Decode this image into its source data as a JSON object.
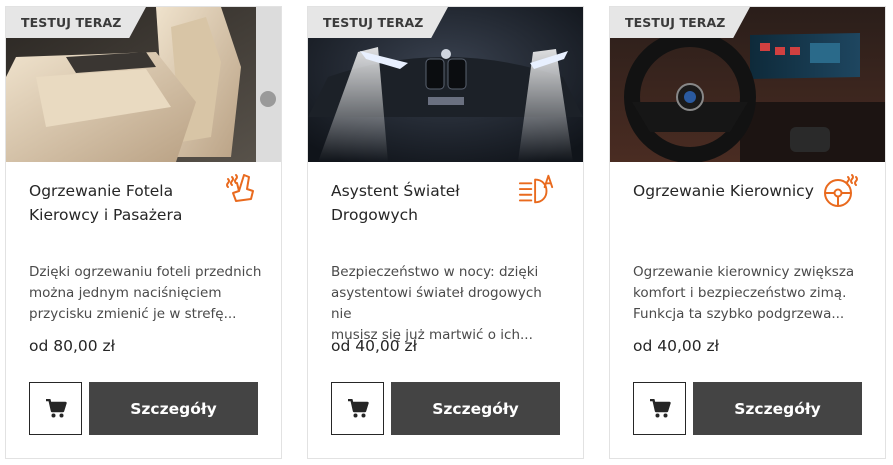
{
  "colors": {
    "accent": "#e96a1e",
    "button_bg": "#444444",
    "badge_bg": "#e6e6e6",
    "border": "#e2e2e2"
  },
  "cards": [
    {
      "badge": "TESTUJ TERAZ",
      "title_line1": "Ogrzewanie Fotela",
      "title_line2": "Kierowcy i Pasażera",
      "icon": "heated-seat-icon",
      "desc_line1": "Dzięki ogrzewaniu foteli przednich",
      "desc_line2": "można jednym naciśnięciem",
      "desc_line3": "przycisku zmienić je w strefę...",
      "price": "od 80,00 zł",
      "cart_icon": "cart-icon",
      "details_label": "Szczegóły"
    },
    {
      "badge": "TESTUJ TERAZ",
      "title_line1": "Asystent Świateł",
      "title_line2": "Drogowych",
      "icon": "high-beam-assistant-icon",
      "desc_line1": "Bezpieczeństwo w nocy: dzięki",
      "desc_line2": "asystentowi świateł drogowych nie",
      "desc_line3": "musisz się już martwić o ich...",
      "price": "od 40,00 zł",
      "cart_icon": "cart-icon",
      "details_label": "Szczegóły"
    },
    {
      "badge": "TESTUJ TERAZ",
      "title_line1": "Ogrzewanie Kierownicy",
      "title_line2": "",
      "icon": "heated-steering-wheel-icon",
      "desc_line1": "Ogrzewanie kierownicy zwiększa",
      "desc_line2": "komfort i bezpieczeństwo zimą.",
      "desc_line3": "Funkcja ta szybko podgrzewa...",
      "price": "od 40,00 zł",
      "cart_icon": "cart-icon",
      "details_label": "Szczegóły"
    }
  ]
}
